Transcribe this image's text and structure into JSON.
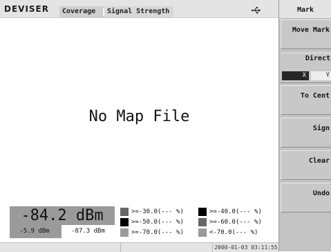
{
  "header": {
    "logo": "DEVISER",
    "tabs": [
      {
        "label": "Coverage"
      },
      {
        "label": "Signal Strength"
      }
    ]
  },
  "map": {
    "message": "No Map File"
  },
  "signal": {
    "value": "-84.2 dBm",
    "min": "-5.9 dBm",
    "max": "-87.3 dBm"
  },
  "legend": [
    {
      "label": ">=-30.0(--- %)",
      "color": "#666666"
    },
    {
      "label": ">=-40.0(--- %)",
      "color": "#000000"
    },
    {
      "label": ">=-50.0(--- %)",
      "color": "#000000"
    },
    {
      "label": ">=-60.0(--- %)",
      "color": "#666666"
    },
    {
      "label": ">=-70.0(--- %)",
      "color": "#9a9a9a"
    },
    {
      "label": "<-70.0(--- %)",
      "color": "#9a9a9a"
    }
  ],
  "status": {
    "datetime": "2000-01-03 03:11:55"
  },
  "panel": {
    "title": "Mark",
    "move_mark": "Move Mark",
    "direction": "Direct",
    "dir_x": "X",
    "dir_y": "Y",
    "to_center": "To Cent",
    "sign": "Sign",
    "clear": "Clear",
    "undo": "Undo"
  },
  "icons": {
    "usb": "usb-icon"
  }
}
